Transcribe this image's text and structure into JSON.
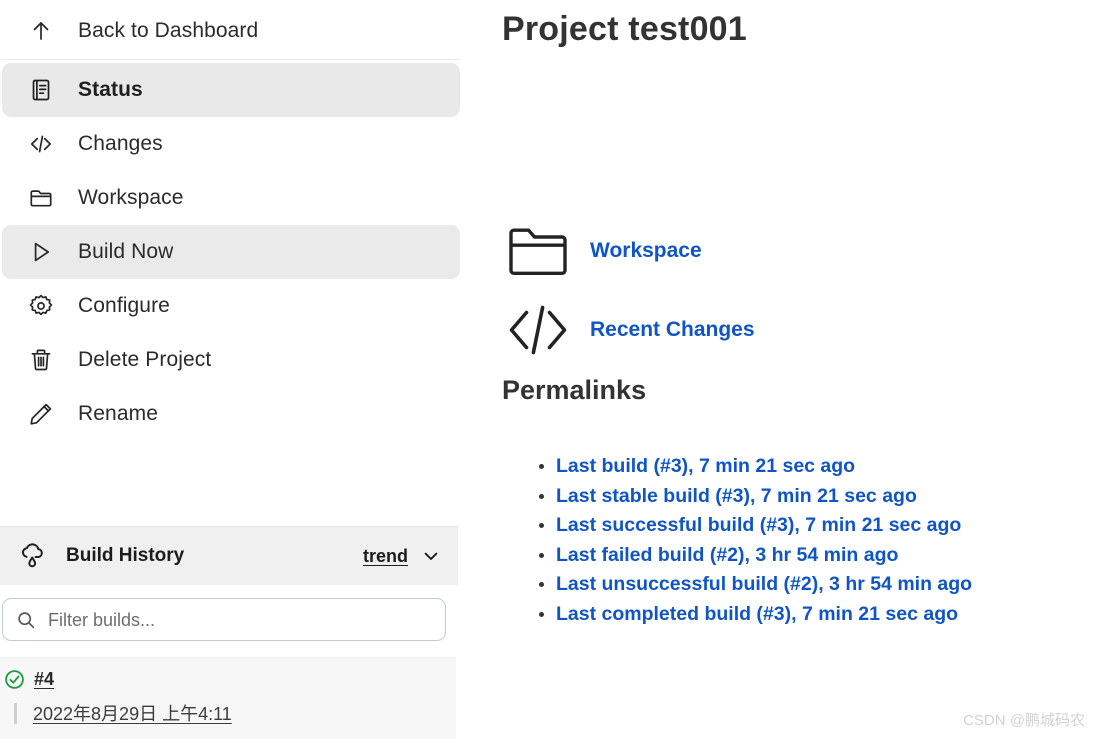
{
  "sidebar": {
    "nav": [
      {
        "label": "Back to Dashboard",
        "icon": "arrow-up-icon",
        "state": "normal"
      },
      {
        "label": "Status",
        "icon": "document-icon",
        "state": "selected"
      },
      {
        "label": "Changes",
        "icon": "code-icon",
        "state": "normal"
      },
      {
        "label": "Workspace",
        "icon": "folder-icon",
        "state": "normal"
      },
      {
        "label": "Build Now",
        "icon": "play-icon",
        "state": "hovered"
      },
      {
        "label": "Configure",
        "icon": "gear-icon",
        "state": "normal"
      },
      {
        "label": "Delete Project",
        "icon": "trash-icon",
        "state": "normal"
      },
      {
        "label": "Rename",
        "icon": "pencil-icon",
        "state": "normal"
      }
    ],
    "build_history": {
      "title": "Build History",
      "icon": "weather-cloud-rain-icon",
      "trend_label": "trend",
      "chevron_icon": "chevron-down-icon",
      "search_placeholder": "Filter builds...",
      "search_value": "",
      "search_icon": "search-icon",
      "builds": [
        {
          "number": "#4",
          "timestamp": "2022年8月29日 上午4:11",
          "status_icon": "success-check-circle-icon",
          "status_color": "#1a9e3f"
        }
      ]
    }
  },
  "main": {
    "title": "Project test001",
    "shortcuts": [
      {
        "label": "Workspace",
        "icon": "folder-icon"
      },
      {
        "label": "Recent Changes",
        "icon": "code-icon"
      }
    ],
    "permalinks_heading": "Permalinks",
    "permalinks": [
      "Last build (#3), 7 min 21 sec ago",
      "Last stable build (#3), 7 min 21 sec ago",
      "Last successful build (#3), 7 min 21 sec ago",
      "Last failed build (#2), 3 hr 54 min ago",
      "Last unsuccessful build (#2), 3 hr 54 min ago",
      "Last completed build (#3), 7 min 21 sec ago"
    ]
  },
  "watermark": "CSDN @鹏城码农",
  "colors": {
    "link_blue": "#1055c4",
    "selected_bg": "#e9e9e9",
    "hover_bg": "#eaeaea",
    "panel_header_bg": "#f0f0f0",
    "build_row_bg": "#f7f7f7",
    "success_green": "#1a9e3f",
    "text_dark": "#2b2b2b"
  }
}
